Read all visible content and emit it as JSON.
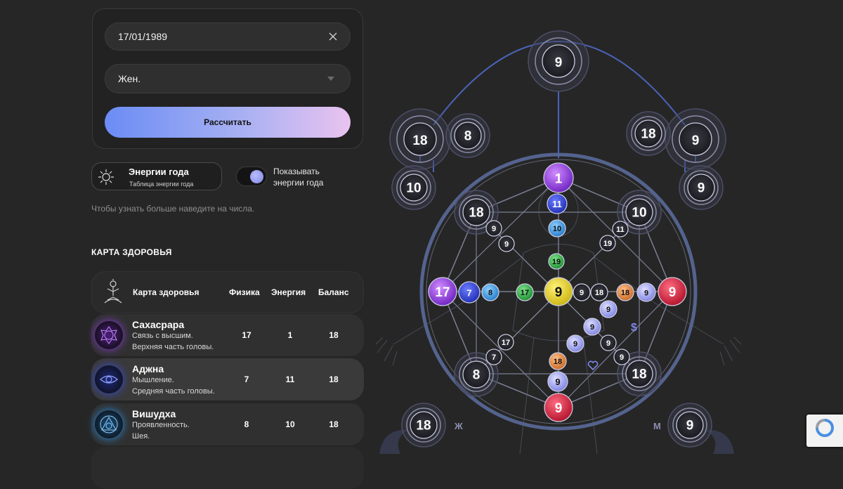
{
  "form": {
    "date_value": "17/01/1989",
    "gender_value": "Жен.",
    "calc_label": "Рассчитать"
  },
  "year_energy": {
    "title": "Энергии года",
    "subtitle": "Таблица энергии года",
    "toggle_label_1": "Показывать",
    "toggle_label_2": "энергии года"
  },
  "hint": "Чтобы узнать больше наведите на числа.",
  "health": {
    "title": "КАРТА ЗДОРОВЬЯ",
    "columns": [
      "Карта здоровья",
      "Физика",
      "Энергия",
      "Баланс"
    ],
    "rows": [
      {
        "name": "Сахасрара",
        "desc1": "Связь с высшим.",
        "desc2": "Верхняя часть головы.",
        "physics": "17",
        "energy": "1",
        "balance": "18",
        "color": "#8b3fd6"
      },
      {
        "name": "Аджна",
        "desc1": "Мышление.",
        "desc2": "Средняя часть головы.",
        "physics": "7",
        "energy": "11",
        "balance": "18",
        "color": "#3a4fd8"
      },
      {
        "name": "Вишудха",
        "desc1": "Проявленность.",
        "desc2": "Шея.",
        "physics": "8",
        "energy": "10",
        "balance": "18",
        "color": "#2c8fe0"
      }
    ]
  },
  "matrix": {
    "top": "9",
    "left_outer": "18",
    "left_mid": "8",
    "left_low": "10",
    "right_outer": "9",
    "right_mid": "18",
    "right_low": "9",
    "crown": "1",
    "c2": "11",
    "c3": "10",
    "c4": "19",
    "center": "9",
    "ul_big": "18",
    "ul_a": "9",
    "ul_b": "9",
    "ur_big": "10",
    "ur_a": "11",
    "ur_b": "19",
    "left_big": "17",
    "l1": "7",
    "l2": "8",
    "l3": "17",
    "r0": "9",
    "r1": "18",
    "r2": "18",
    "r3": "9",
    "right_big": "9",
    "diag1": "9",
    "diag2": "9",
    "diag3": "9",
    "ll_big": "8",
    "ll_a": "7",
    "ll_b": "17",
    "lr_big": "18",
    "lr_a": "9",
    "lr_b": "9",
    "b1": "18",
    "b2": "9",
    "bottom": "9",
    "corner_left": "18",
    "corner_right": "9",
    "label_f": "Ж",
    "label_m": "М",
    "dollar": "$"
  },
  "colors": {
    "accent": "#6b8cf5",
    "purple": "#9a3df0",
    "blue": "#2f45e0",
    "teal": "#3aa0e8",
    "green": "#2fb84a",
    "yellow": "#e5d21f",
    "orange": "#e08a3a",
    "lav": "#a8acf5",
    "red": "#e0203c"
  }
}
